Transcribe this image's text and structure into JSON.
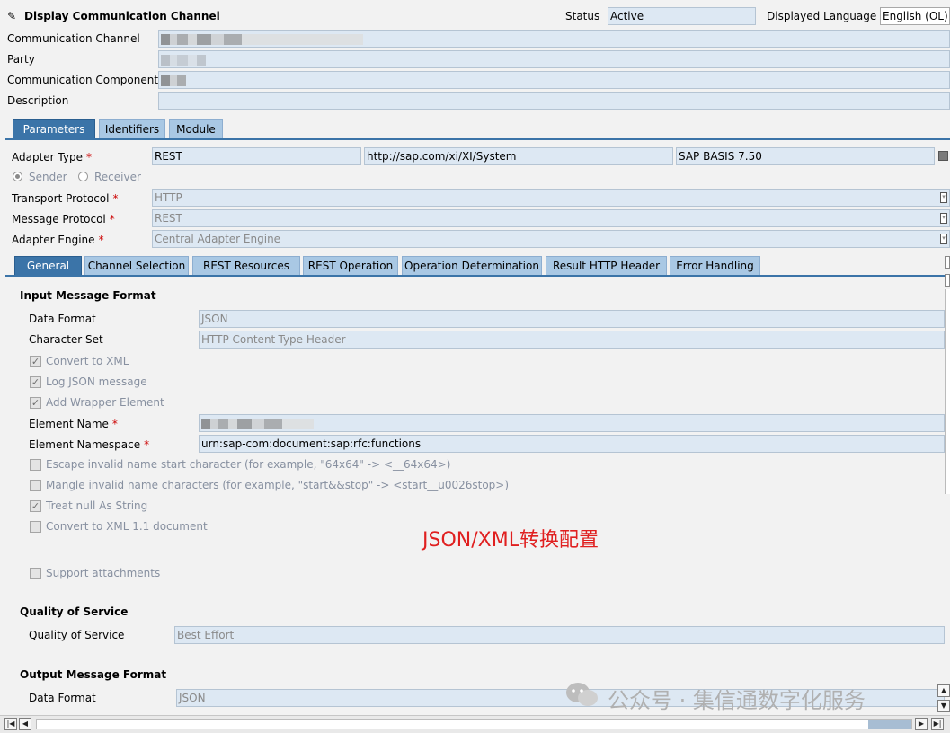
{
  "header": {
    "title": "Display Communication Channel",
    "status_label": "Status",
    "status_value": "Active",
    "language_label": "Displayed Language",
    "language_value": "English (OL)"
  },
  "channel": {
    "communication_channel_label": "Communication Channel",
    "party_label": "Party",
    "communication_component_label": "Communication Component",
    "description_label": "Description"
  },
  "main_tabs": [
    "Parameters",
    "Identifiers",
    "Module"
  ],
  "parameters": {
    "adapter_type_label": "Adapter Type",
    "adapter_type_value": "REST",
    "adapter_namespace": "http://sap.com/xi/XI/System",
    "adapter_swcv": "SAP BASIS 7.50",
    "sender_label": "Sender",
    "receiver_label": "Receiver",
    "transport_protocol_label": "Transport Protocol",
    "transport_protocol_value": "HTTP",
    "message_protocol_label": "Message Protocol",
    "message_protocol_value": "REST",
    "adapter_engine_label": "Adapter Engine",
    "adapter_engine_value": "Central Adapter Engine",
    "required_mark": "*"
  },
  "sub_tabs": [
    "General",
    "Channel Selection",
    "REST Resources",
    "REST Operation",
    "Operation Determination",
    "Result HTTP Header",
    "Error Handling"
  ],
  "input_format": {
    "title": "Input Message Format",
    "data_format_label": "Data Format",
    "data_format_value": "JSON",
    "character_set_label": "Character Set",
    "character_set_value": "HTTP Content-Type Header",
    "convert_to_xml": "Convert to XML",
    "log_json": "Log JSON message",
    "add_wrapper": "Add Wrapper Element",
    "element_name_label": "Element Name",
    "element_namespace_label": "Element Namespace",
    "element_namespace_value": "urn:sap-com:document:sap:rfc:functions",
    "escape_invalid": "Escape invalid name start character (for example, \"64x64\" -> <__64x64>)",
    "mangle_invalid": "Mangle invalid name characters (for example, \"start&&stop\" -> <start__u0026stop>)",
    "treat_null": "Treat null As String",
    "convert_xml11": "Convert to XML 1.1 document",
    "support_attachments": "Support attachments"
  },
  "annotation": "JSON/XML转换配置",
  "qos": {
    "title": "Quality of Service",
    "label": "Quality of Service",
    "value": "Best Effort"
  },
  "output_format": {
    "title": "Output Message Format",
    "data_format_label": "Data Format",
    "data_format_value": "JSON"
  },
  "watermark": "公众号 · 集信通数字化服务",
  "colors": {
    "tab_active": "#3b74a8",
    "tab_inactive": "#a9c8e4",
    "field_bg": "#dde8f3",
    "annotation": "#e02020"
  }
}
